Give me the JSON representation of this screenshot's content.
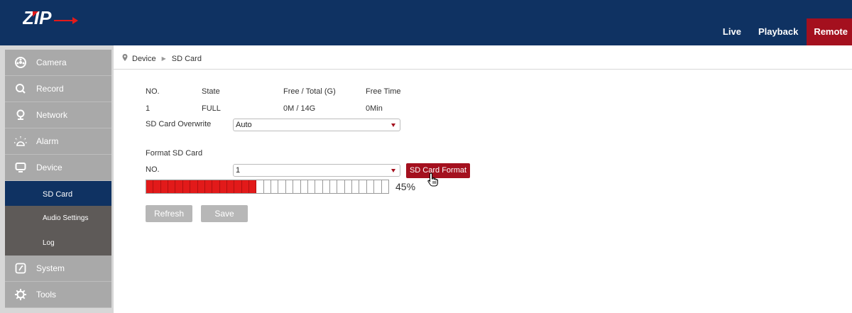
{
  "header": {
    "logo_text": "ZIP",
    "nav": [
      "Live",
      "Playback",
      "Remote"
    ]
  },
  "sidebar": {
    "items": [
      {
        "label": "Camera",
        "icon": "camera-dial-icon"
      },
      {
        "label": "Record",
        "icon": "search-icon"
      },
      {
        "label": "Network",
        "icon": "network-pin-icon"
      },
      {
        "label": "Alarm",
        "icon": "alarm-bulb-icon"
      },
      {
        "label": "Device",
        "icon": "monitor-icon"
      }
    ],
    "subitems": [
      "SD Card",
      "Audio Settings",
      "Log"
    ],
    "items_after": [
      {
        "label": "System",
        "icon": "system-icon"
      },
      {
        "label": "Tools",
        "icon": "gear-icon"
      }
    ]
  },
  "breadcrumb": {
    "root": "Device",
    "current": "SD Card"
  },
  "table": {
    "headers": [
      "NO.",
      "State",
      "Free / Total (G)",
      "Free Time"
    ],
    "row": [
      "1",
      "FULL",
      "0M / 14G",
      "0Min"
    ]
  },
  "overwrite": {
    "label": "SD Card Overwrite",
    "value": "Auto"
  },
  "format": {
    "section_label": "Format SD Card",
    "no_label": "NO.",
    "no_value": "1",
    "button": "SD Card Format",
    "progress": 45,
    "progress_text": "45%"
  },
  "buttons": {
    "refresh": "Refresh",
    "save": "Save"
  },
  "colors": {
    "header": "#0f3262",
    "accent": "#a4101e",
    "progress": "#e21a1a"
  }
}
